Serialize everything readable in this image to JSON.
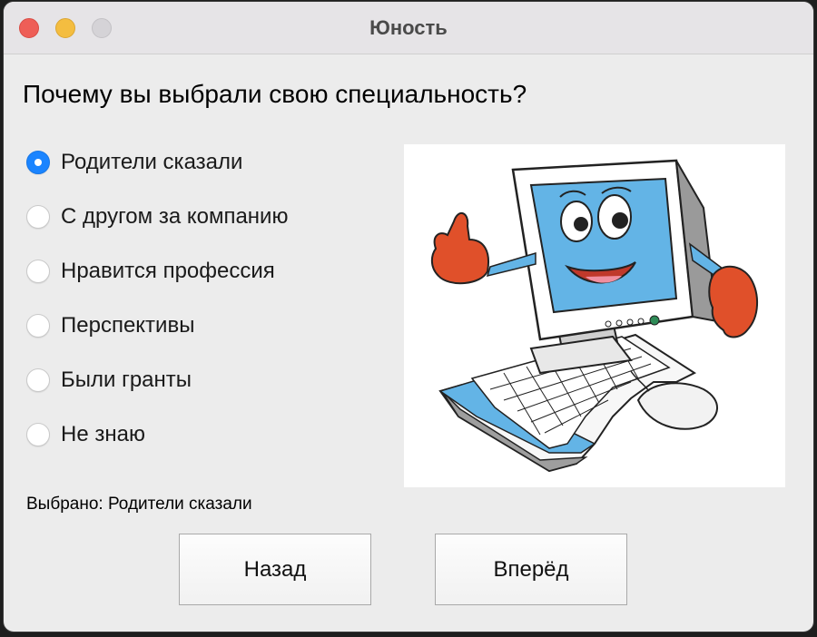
{
  "window": {
    "title": "Юность"
  },
  "question": "Почему вы выбрали свою специальность?",
  "options": [
    {
      "label": "Родители сказали",
      "selected": true
    },
    {
      "label": "С другом за компанию",
      "selected": false
    },
    {
      "label": "Нравится профессия",
      "selected": false
    },
    {
      "label": "Перспективы",
      "selected": false
    },
    {
      "label": "Были гранты",
      "selected": false
    },
    {
      "label": "Не знаю",
      "selected": false
    }
  ],
  "status": "Выбрано: Родители сказали",
  "buttons": {
    "back": "Назад",
    "next": "Вперёд"
  },
  "illustration": {
    "icon": "cartoon-computer-thumbs-up"
  },
  "colors": {
    "accent": "#1a84ff",
    "screen": "#63b4e6",
    "gloves": "#e0502a"
  }
}
